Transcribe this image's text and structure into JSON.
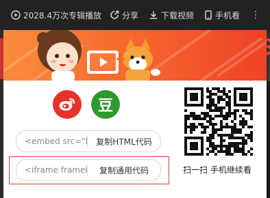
{
  "toolbar": {
    "plays": "2028.4万次专辑播放",
    "share": "分享",
    "download": "下载视频",
    "mobile": "手机看",
    "more": "⋮"
  },
  "share_panel": {
    "douban_glyph": "豆",
    "html_code_preview": "<embed src=\"h",
    "copy_html_label": "复制HTML代码",
    "iframe_code_preview": "<iframe framebo",
    "copy_general_label": "复制通用代码",
    "qr_caption": "扫一扫 手机继续看"
  },
  "colors": {
    "weibo": "#e6322c",
    "douban": "#2e9a2e",
    "banner_orange": "#f66a2e",
    "highlight_border": "#d23a3a"
  },
  "icons": [
    "play-circle-icon",
    "share-icon",
    "download-icon",
    "phone-icon",
    "more-icon",
    "weibo-icon",
    "qr-code-icon"
  ]
}
